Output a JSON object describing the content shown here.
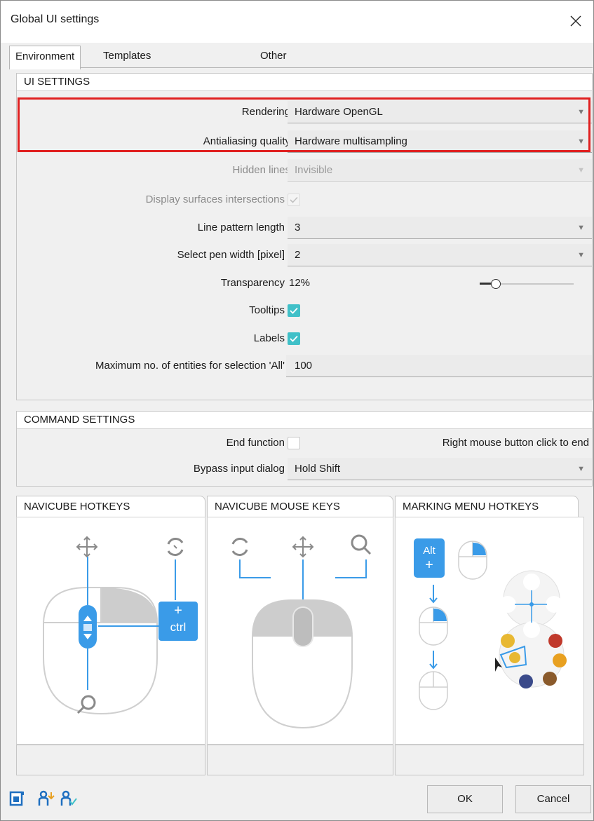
{
  "window": {
    "title": "Global UI settings"
  },
  "tabs": [
    {
      "label": "Environment",
      "active": true
    },
    {
      "label": "Templates & directories",
      "active": false
    },
    {
      "label": "Other",
      "active": false
    }
  ],
  "ui_settings": {
    "header": "UI SETTINGS",
    "rendering": {
      "label": "Rendering",
      "value": "Hardware OpenGL"
    },
    "antialiasing": {
      "label": "Antialiasing quality",
      "value": "Hardware multisampling"
    },
    "hidden_lines": {
      "label": "Hidden lines",
      "value": "Invisible"
    },
    "surfaces_intersections": {
      "label": "Display surfaces intersections",
      "checked": true
    },
    "line_pattern": {
      "label": "Line pattern length",
      "value": "3"
    },
    "pen_width": {
      "label": "Select pen width [pixel]",
      "value": "2"
    },
    "transparency": {
      "label": "Transparency",
      "value": "12%",
      "level": 0.12
    },
    "tooltips": {
      "label": "Tooltips",
      "checked": true
    },
    "labels": {
      "label": "Labels",
      "checked": true
    },
    "max_entities": {
      "label": "Maximum no. of entities for selection 'All'",
      "value": "100"
    }
  },
  "command_settings": {
    "header": "COMMAND SETTINGS",
    "end_function": {
      "label": "End function",
      "checked": false,
      "hint": "Right mouse button click to end"
    },
    "bypass": {
      "label": "Bypass input dialog",
      "value": "Hold Shift"
    }
  },
  "navicube": {
    "hotkeys_label": "NAVICUBE HOTKEYS",
    "mouse_keys_label": "NAVICUBE MOUSE KEYS",
    "marking_menu_label": "MARKING MENU HOTKEYS",
    "ctrl_key": "ctrl",
    "alt_key": "Alt"
  },
  "buttons": {
    "ok": "OK",
    "cancel": "Cancel"
  },
  "colors": {
    "accent": "#3a9be8",
    "check": "#40c0c8",
    "highlight": "#e02020"
  }
}
